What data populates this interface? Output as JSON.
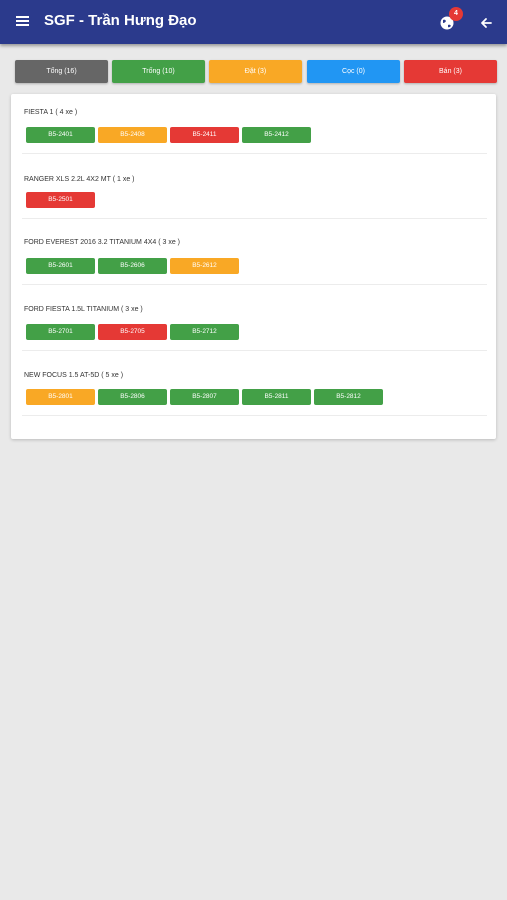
{
  "app": {
    "title": "SGF - Trần Hưng Đạo",
    "notification_count": "4"
  },
  "colors": {
    "bar": "#2b3a8c",
    "total": "#666666",
    "green": "#43a047",
    "orange": "#f9a825",
    "blue": "#2196f3",
    "red": "#e53935"
  },
  "filters": [
    {
      "label": "Tổng (16)",
      "color": "#666666"
    },
    {
      "label": "Trống (10)",
      "color": "#43a047"
    },
    {
      "label": "Đặt (3)",
      "color": "#f9a825"
    },
    {
      "label": "Cọc (0)",
      "color": "#2196f3"
    },
    {
      "label": "Bán (3)",
      "color": "#e53935"
    }
  ],
  "models": [
    {
      "title": "FIESTA 1 ( 4 xe )",
      "units": [
        {
          "code": "B5-2401",
          "status": "green"
        },
        {
          "code": "B5-2408",
          "status": "orange"
        },
        {
          "code": "B5-2411",
          "status": "red"
        },
        {
          "code": "B5-2412",
          "status": "green"
        }
      ]
    },
    {
      "title": "RANGER XLS 2.2L 4X2 MT ( 1 xe )",
      "units": [
        {
          "code": "B5-2501",
          "status": "red"
        }
      ]
    },
    {
      "title": "FORD EVEREST 2016 3.2 TITANIUM 4X4 ( 3 xe )",
      "units": [
        {
          "code": "B5-2601",
          "status": "green"
        },
        {
          "code": "B5-2606",
          "status": "green"
        },
        {
          "code": "B5-2612",
          "status": "orange"
        }
      ]
    },
    {
      "title": "FORD FIESTA 1.5L TITANIUM ( 3 xe )",
      "units": [
        {
          "code": "B5-2701",
          "status": "green"
        },
        {
          "code": "B5-2705",
          "status": "red"
        },
        {
          "code": "B5-2712",
          "status": "green"
        }
      ]
    },
    {
      "title": "NEW FOCUS 1.5 AT-5D ( 5 xe )",
      "units": [
        {
          "code": "B5-2801",
          "status": "orange"
        },
        {
          "code": "B5-2806",
          "status": "green"
        },
        {
          "code": "B5-2807",
          "status": "green"
        },
        {
          "code": "B5-2811",
          "status": "green"
        },
        {
          "code": "B5-2812",
          "status": "green"
        }
      ]
    }
  ]
}
